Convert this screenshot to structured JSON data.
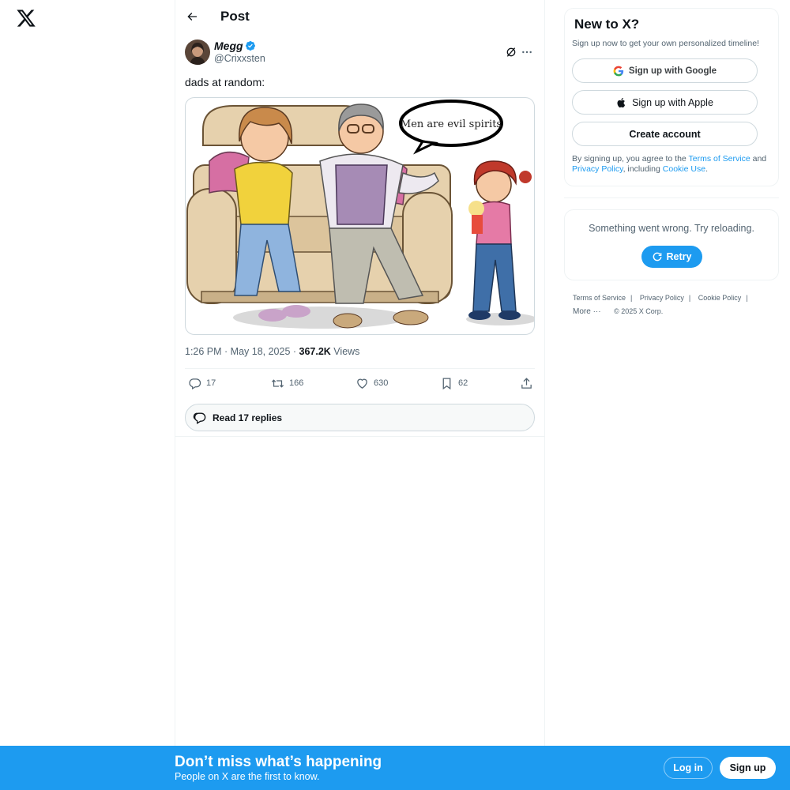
{
  "header": {
    "title": "Post"
  },
  "post": {
    "author_name": "Megg",
    "author_handle": "@Crixxsten",
    "text": "dads at random:",
    "image_caption_text": "Men are evil spirits",
    "time": "1:26 PM · May 18, 2025 · ",
    "views_count": "367.2K",
    "views_label": " Views",
    "replies": "17",
    "retweets": "166",
    "likes": "630",
    "bookmarks": "62",
    "read_replies_label": "Read 17 replies"
  },
  "sidebar": {
    "signup_card": {
      "title": "New to X?",
      "subtitle": "Sign up now to get your own personalized timeline!",
      "google_label": "Sign up with Google",
      "apple_label": "Sign up with Apple",
      "create_label": "Create account",
      "legal_prefix": "By signing up, you agree to the ",
      "terms_link": "Terms of Service",
      "legal_and": " and ",
      "privacy_link": "Privacy Policy",
      "legal_including": ", including ",
      "cookie_link": "Cookie Use",
      "legal_suffix": "."
    },
    "error": {
      "message": "Something went wrong. Try reloading.",
      "retry_label": "Retry"
    },
    "footer": {
      "terms": "Terms of Service",
      "privacy": "Privacy Policy",
      "cookie": "Cookie Policy",
      "more": "More",
      "copyright": "© 2025 X Corp."
    }
  },
  "banner": {
    "title": "Don’t miss what’s happening",
    "subtitle": "People on X are the first to know.",
    "login_label": "Log in",
    "signup_label": "Sign up"
  },
  "colors": {
    "accent": "#1d9bf0",
    "text": "#0f1419",
    "secondary": "#536471",
    "border": "#cfd9de"
  },
  "icons": [
    "x-logo-icon",
    "back-arrow-icon",
    "verified-badge-icon",
    "grok-icon",
    "more-icon",
    "reply-icon",
    "retweet-icon",
    "like-icon",
    "bookmark-icon",
    "share-icon",
    "replies-bubble-icon",
    "google-icon",
    "apple-icon",
    "refresh-icon"
  ]
}
